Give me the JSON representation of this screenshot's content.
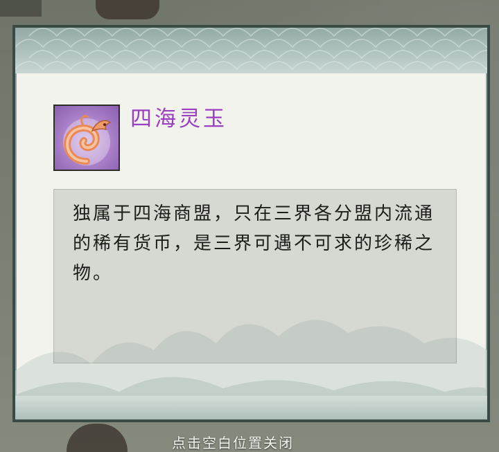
{
  "item": {
    "name": "四海灵玉",
    "description": "独属于四海商盟，只在三界各分盟内流通的稀有货币，是三界可遇不可求的珍稀之物。",
    "icon": "jade-dragon-icon"
  },
  "footer": {
    "close_hint": "点击空白位置关闭"
  },
  "colors": {
    "item_name": "#9a3fbf",
    "dialog_border": "#3a4b46",
    "dialog_bg": "#f1f3ec",
    "icon_bg": "#a77ec7"
  }
}
